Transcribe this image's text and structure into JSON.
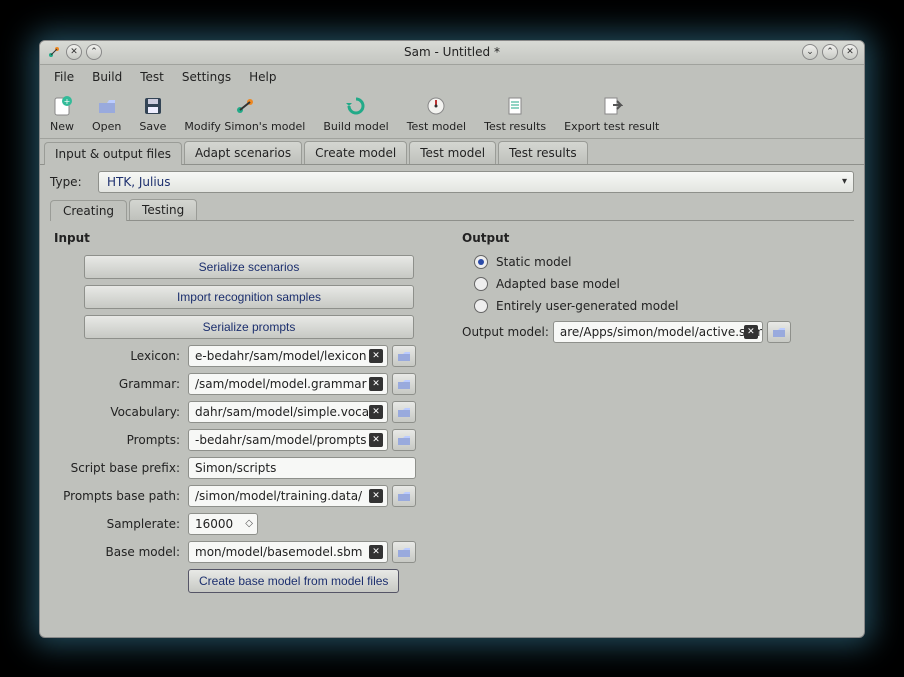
{
  "window": {
    "title": "Sam - Untitled *"
  },
  "menu": {
    "file": "File",
    "build": "Build",
    "test": "Test",
    "settings": "Settings",
    "help": "Help"
  },
  "toolbar": {
    "new": "New",
    "open": "Open",
    "save": "Save",
    "modify": "Modify Simon's model",
    "build": "Build model",
    "testmodel": "Test model",
    "testresults": "Test results",
    "export": "Export test result"
  },
  "tabs": {
    "io": "Input & output files",
    "adapt": "Adapt scenarios",
    "create": "Create model",
    "testmodel": "Test model",
    "testresults": "Test results"
  },
  "type": {
    "label": "Type:",
    "value": "HTK, Julius"
  },
  "subtabs": {
    "creating": "Creating",
    "testing": "Testing"
  },
  "input": {
    "header": "Input",
    "serialize_scenarios": "Serialize scenarios",
    "import_samples": "Import recognition samples",
    "serialize_prompts": "Serialize prompts",
    "lexicon_label": "Lexicon:",
    "lexicon_value": "e-bedahr/sam/model/lexicon",
    "grammar_label": "Grammar:",
    "grammar_value": "/sam/model/model.grammar",
    "vocabulary_label": "Vocabulary:",
    "vocabulary_value": "dahr/sam/model/simple.voca",
    "prompts_label": "Prompts:",
    "prompts_value": "-bedahr/sam/model/prompts",
    "script_prefix_label": "Script base prefix:",
    "script_prefix_value": "Simon/scripts",
    "prompts_base_label": "Prompts base path:",
    "prompts_base_value": "/simon/model/training.data/",
    "samplerate_label": "Samplerate:",
    "samplerate_value": "16000",
    "basemodel_label": "Base model:",
    "basemodel_value": "mon/model/basemodel.sbm",
    "create_base_btn": "Create base model from model files"
  },
  "output": {
    "header": "Output",
    "static": "Static model",
    "adapted": "Adapted base model",
    "usergen": "Entirely user-generated model",
    "outmodel_label": "Output model:",
    "outmodel_value": "are/Apps/simon/model/active.sbm"
  }
}
